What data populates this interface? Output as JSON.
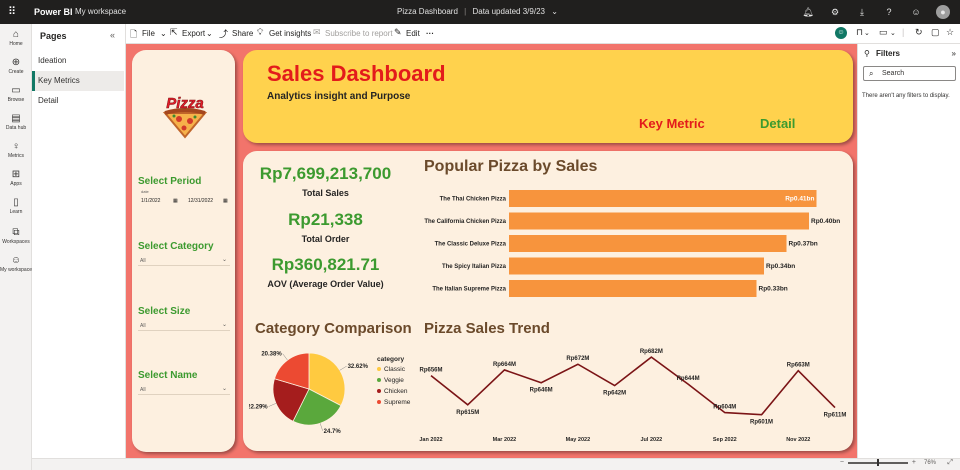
{
  "app": {
    "name": "Power BI",
    "workspace": "My workspace",
    "report_title": "Pizza Dashboard",
    "data_updated": "Data updated 3/9/23"
  },
  "left_rail": [
    {
      "label": "Home",
      "icon": "home-icon"
    },
    {
      "label": "Create",
      "icon": "plus-circle-icon"
    },
    {
      "label": "Browse",
      "icon": "folder-icon"
    },
    {
      "label": "Data hub",
      "icon": "database-icon"
    },
    {
      "label": "Metrics",
      "icon": "trophy-icon"
    },
    {
      "label": "Apps",
      "icon": "apps-icon"
    },
    {
      "label": "Learn",
      "icon": "book-icon"
    },
    {
      "label": "Workspaces",
      "icon": "workspaces-icon"
    },
    {
      "label": "My workspace",
      "icon": "person-icon"
    }
  ],
  "pages": {
    "title": "Pages",
    "items": [
      {
        "label": "Ideation"
      },
      {
        "label": "Key Metrics",
        "active": true
      },
      {
        "label": "Detail"
      }
    ]
  },
  "toolbar": {
    "file": "File",
    "export": "Export",
    "share": "Share",
    "insights": "Get insights",
    "subscribe": "Subscribe to report",
    "edit": "Edit",
    "more": "···"
  },
  "filters": {
    "title": "Filters",
    "search_placeholder": "Search",
    "empty_text": "There aren't any filters to display."
  },
  "status": {
    "zoom": "76%"
  },
  "dashboard": {
    "title": "Sales Dashboard",
    "subtitle": "Analytics insight and Purpose",
    "nav_key_metric": "Key Metric",
    "nav_detail": "Detail",
    "logo_text": "Pizza",
    "slicers": {
      "period_label": "Select Period",
      "date_caption": "date",
      "date_start": "1/1/2022",
      "date_end": "12/31/2022",
      "category_label": "Select Category",
      "category_value": "All",
      "size_label": "Select Size",
      "size_value": "All",
      "name_label": "Select Name",
      "name_value": "All"
    },
    "kpis": [
      {
        "value": "Rp7,699,213,700",
        "label": "Total Sales"
      },
      {
        "value": "Rp21,338",
        "label": "Total Order"
      },
      {
        "value": "Rp360,821.71",
        "label": "AOV (Average Order Value)"
      }
    ],
    "section_popular": "Popular Pizza by Sales",
    "section_category": "Category Comparison",
    "section_trend": "Pizza Sales Trend",
    "colors": {
      "canvas": "#f2746b",
      "panel": "#fdf0e0",
      "header": "#ffd24d",
      "accent_red": "#e31b1b",
      "accent_green": "#3c9a2f",
      "bar": "#f7943d",
      "trend_line": "#7b1416"
    }
  },
  "chart_data": [
    {
      "type": "bar",
      "orientation": "horizontal",
      "title": "Popular Pizza by Sales",
      "categories": [
        "The Thai Chicken Pizza",
        "The California Chicken Pizza",
        "The Classic Deluxe Pizza",
        "The Spicy Italian Pizza",
        "The Italian Supreme Pizza"
      ],
      "values": [
        0.41,
        0.4,
        0.37,
        0.34,
        0.33
      ],
      "labels": [
        "Rp0.41bn",
        "Rp0.40bn",
        "Rp0.37bn",
        "Rp0.34bn",
        "Rp0.33bn"
      ],
      "color": "#f7943d"
    },
    {
      "type": "pie",
      "title": "Category Comparison",
      "legend_title": "category",
      "categories": [
        "Classic",
        "Veggie",
        "Chicken",
        "Supreme"
      ],
      "values": [
        32.62,
        24.7,
        22.29,
        20.38
      ],
      "labels": [
        "32.62%",
        "24.7%",
        "22.29%",
        "20.38%"
      ],
      "colors": [
        "#ffca40",
        "#5aa83c",
        "#a51d1d",
        "#ec4a32"
      ],
      "legend_placement": "right"
    },
    {
      "type": "line",
      "title": "Pizza Sales Trend",
      "x": [
        "Jan 2022",
        "Feb 2022",
        "Mar 2022",
        "Apr 2022",
        "May 2022",
        "Jun 2022",
        "Jul 2022",
        "Aug 2022",
        "Sep 2022",
        "Oct 2022",
        "Nov 2022",
        "Dec 2022"
      ],
      "values": [
        656,
        615,
        664,
        646,
        672,
        642,
        682,
        644,
        604,
        601,
        663,
        611
      ],
      "labels": [
        "Rp656M",
        "Rp615M",
        "Rp664M",
        "Rp646M",
        "Rp672M",
        "Rp642M",
        "Rp682M",
        "Rp644M",
        "Rp604M",
        "Rp601M",
        "Rp663M",
        "Rp611M"
      ],
      "tick_labels": [
        "Jan 2022",
        "Mar 2022",
        "May 2022",
        "Jul 2022",
        "Sep 2022",
        "Nov 2022"
      ],
      "color": "#7b1416"
    }
  ]
}
